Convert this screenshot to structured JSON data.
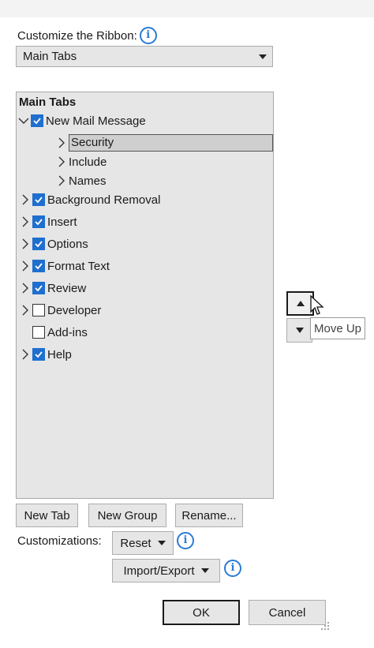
{
  "dialog": {
    "customize_label": "Customize the Ribbon:",
    "select_value": "Main Tabs"
  },
  "tree": {
    "heading": "Main Tabs",
    "items": [
      {
        "label": "New Mail Message",
        "checked": true,
        "expanded": true
      },
      {
        "label": "Security",
        "selected": true
      },
      {
        "label": "Include"
      },
      {
        "label": "Names"
      },
      {
        "label": "Background Removal",
        "checked": true
      },
      {
        "label": "Insert",
        "checked": true
      },
      {
        "label": "Options",
        "checked": true
      },
      {
        "label": "Format Text",
        "checked": true
      },
      {
        "label": "Review",
        "checked": true
      },
      {
        "label": "Developer",
        "checked": false
      },
      {
        "label": "Add-ins",
        "checked": false
      },
      {
        "label": "Help",
        "checked": true
      }
    ]
  },
  "move_buttons": {
    "tooltip": "Move Up"
  },
  "buttons": {
    "new_tab": "New Tab",
    "new_group": "New Group",
    "rename": "Rename...",
    "customizations_label": "Customizations:",
    "reset": "Reset",
    "import_export": "Import/Export",
    "ok": "OK",
    "cancel": "Cancel"
  },
  "colors": {
    "accent": "#1f6fcf",
    "info": "#2a7bd6",
    "panel": "#e6e6e6"
  }
}
